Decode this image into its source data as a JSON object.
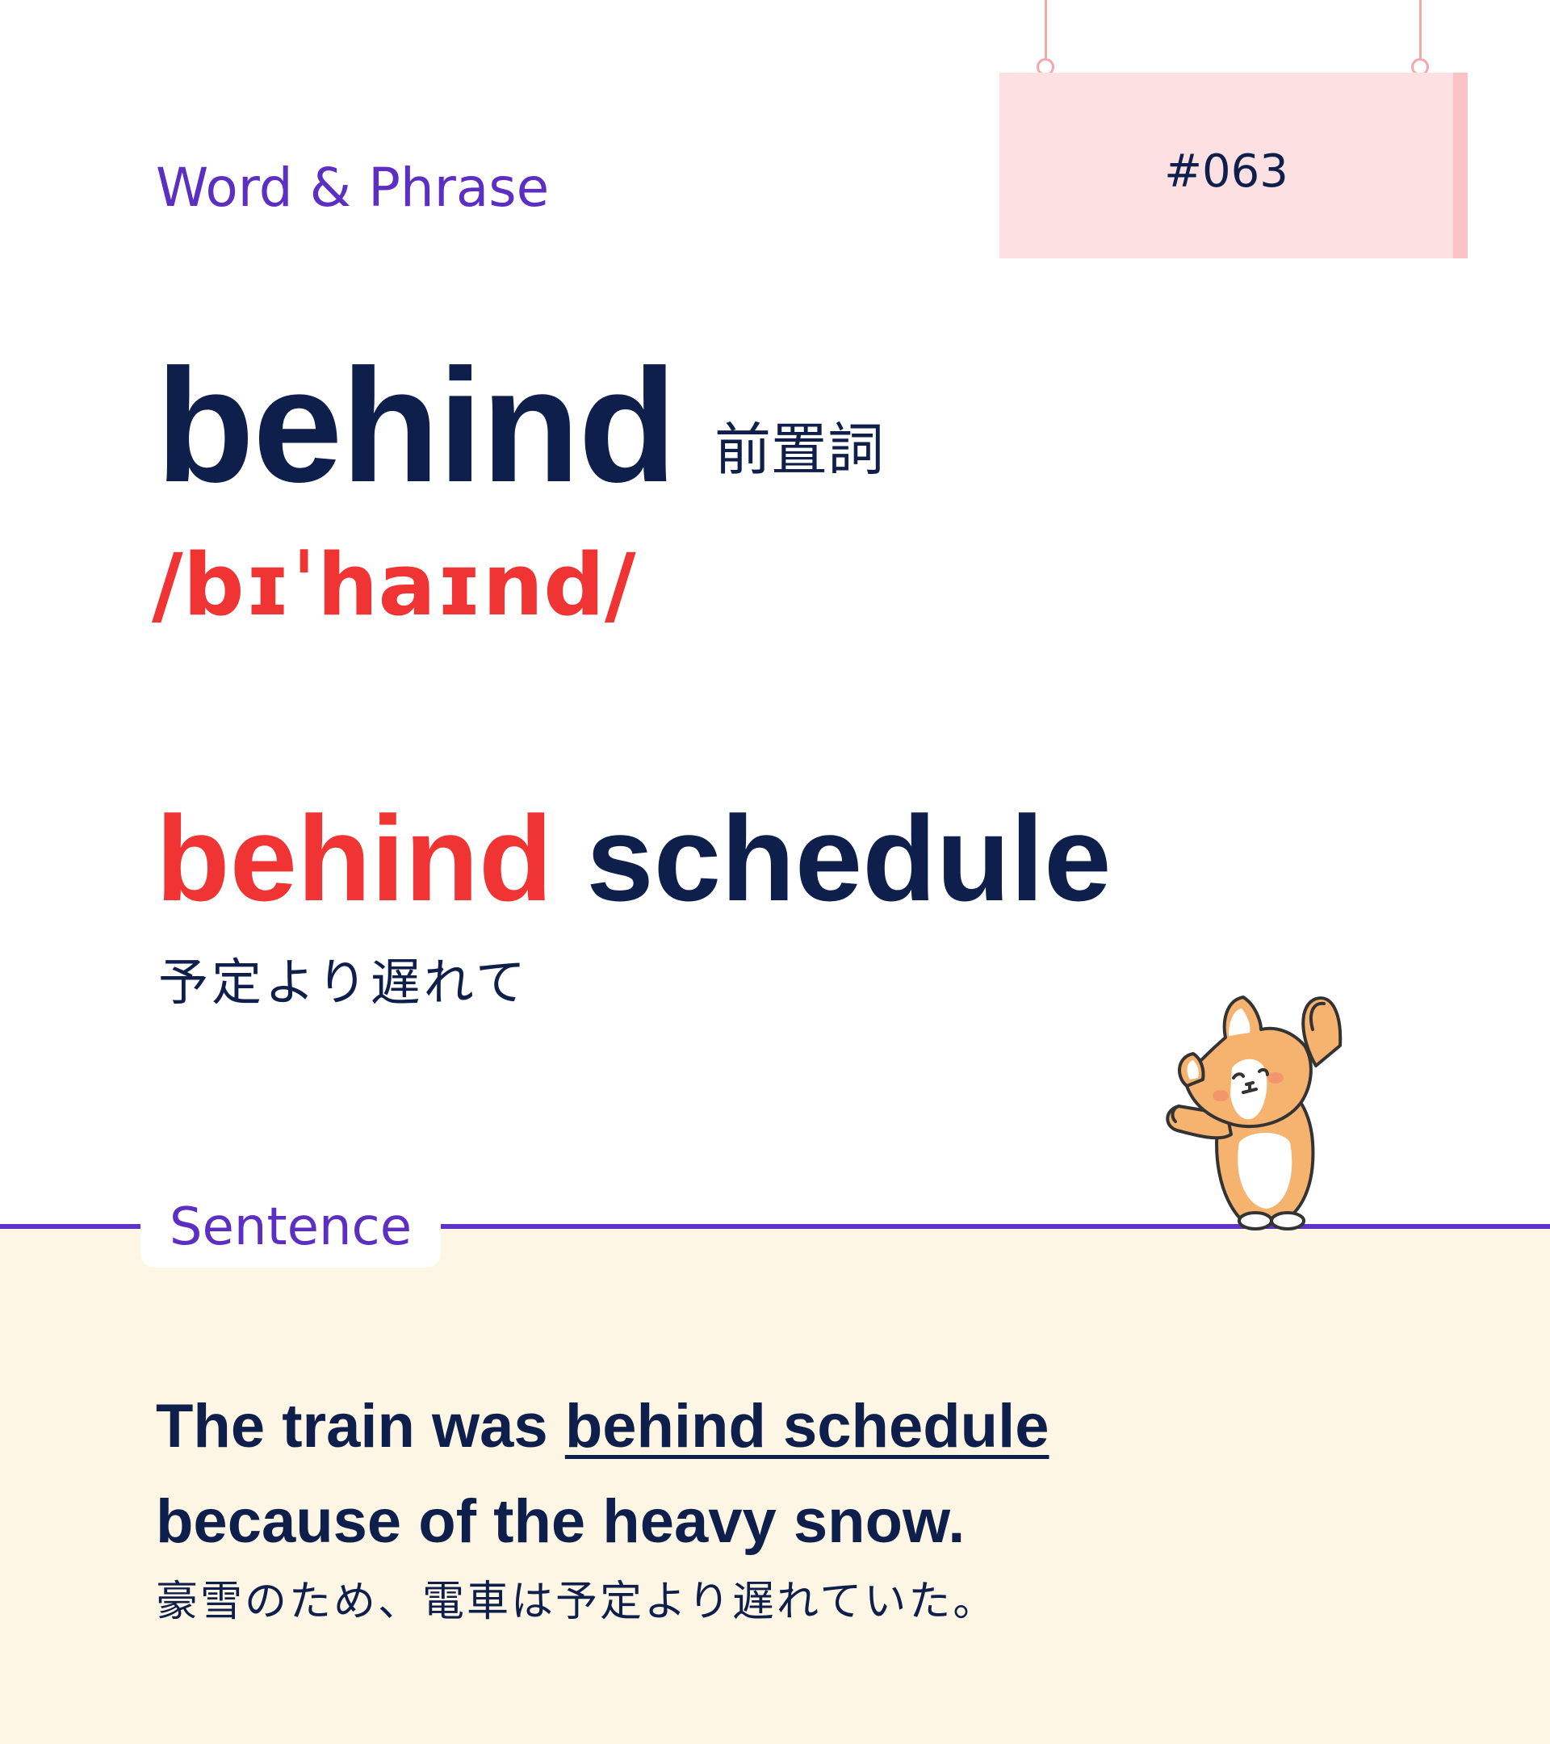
{
  "category": "Word & Phrase",
  "number": "#063",
  "word": "behind",
  "part_of_speech": "前置詞",
  "pronunciation": "/bɪˈhaɪnd/",
  "phrase": {
    "highlight": "behind",
    "rest": " schedule"
  },
  "phrase_translation": "予定より遅れて",
  "section_label": "Sentence",
  "sentence": {
    "before": "The train was ",
    "underlined": "behind schedule",
    "after": "because of the heavy snow."
  },
  "sentence_translation": "豪雪のため、電車は予定より遅れていた。",
  "colors": {
    "navy": "#0f1f4c",
    "red": "#f03333",
    "purple": "#5c2fc2",
    "sign_pink": "#fde0e2",
    "cream": "#fdf6e4"
  },
  "illustration": "corgi-mascot"
}
